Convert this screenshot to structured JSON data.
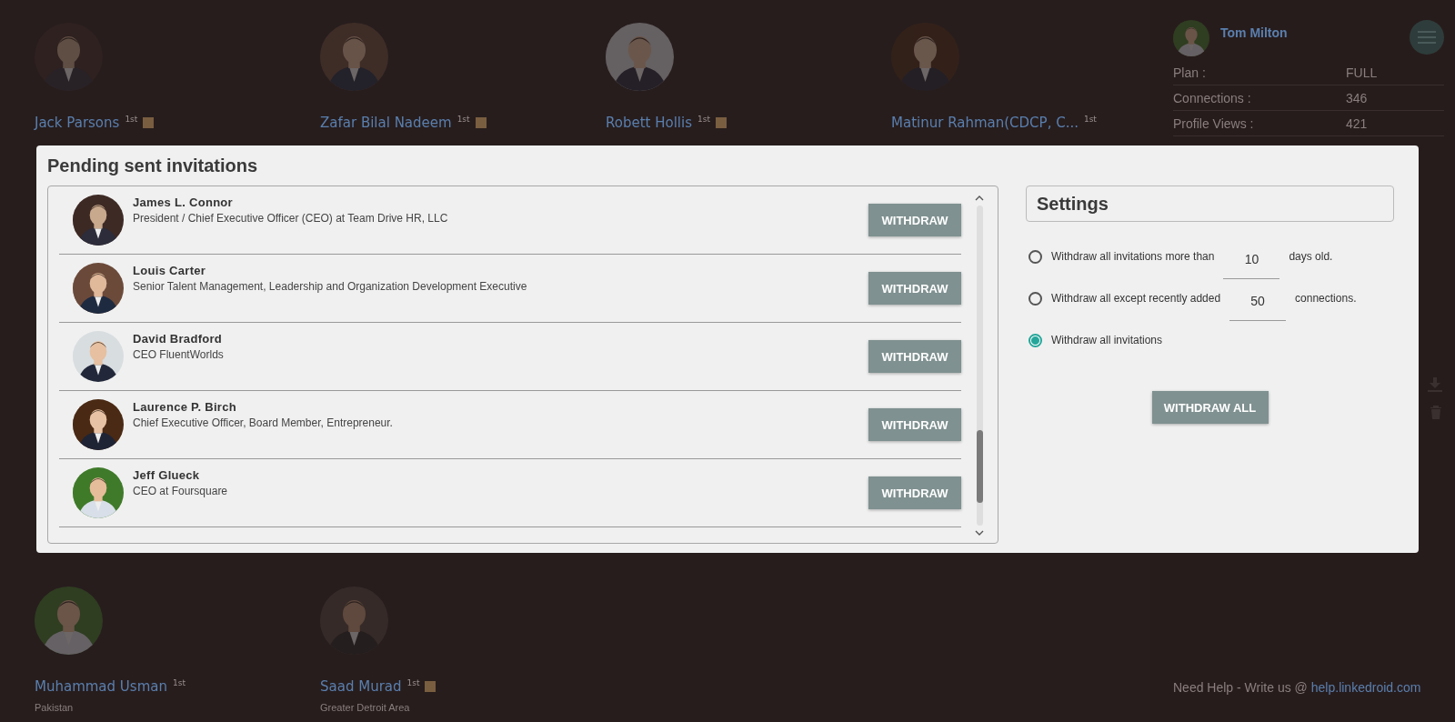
{
  "background_cards": [
    {
      "name": "Jack Parsons",
      "degree": "1st",
      "in_badge": true
    },
    {
      "name": "Zafar Bilal Nadeem",
      "degree": "1st",
      "in_badge": true
    },
    {
      "name": "Robett Hollis",
      "degree": "1st",
      "in_badge": true
    },
    {
      "name": "Matinur Rahman(CDCP, C...",
      "degree": "1st",
      "in_badge": false
    },
    {
      "name": "Muhammad Usman",
      "degree": "1st",
      "in_badge": false,
      "location": "Pakistan"
    },
    {
      "name": "Saad Murad",
      "degree": "1st",
      "in_badge": true,
      "location": "Greater Detroit Area"
    }
  ],
  "account_panel": {
    "user": "Tom Milton",
    "stats": [
      {
        "label": "Plan :",
        "value": "FULL"
      },
      {
        "label": "Connections :",
        "value": "346"
      },
      {
        "label": "Profile Views :",
        "value": "421"
      }
    ],
    "help_text": "Need Help - Write us @",
    "help_link": "help.linkedroid.com"
  },
  "dialog": {
    "title": "Pending sent invitations",
    "invitations": [
      {
        "name": "James L. Connor",
        "headline": "President / Chief Executive Officer (CEO) at Team Drive HR, LLC",
        "button": "WITHDRAW"
      },
      {
        "name": "Louis Carter",
        "headline": "Senior Talent Management, Leadership and Organization Development Executive",
        "button": "WITHDRAW"
      },
      {
        "name": "David Bradford",
        "headline": "CEO FluentWorlds",
        "button": "WITHDRAW"
      },
      {
        "name": "Laurence P. Birch",
        "headline": "Chief Executive Officer, Board Member, Entrepreneur.",
        "button": "WITHDRAW"
      },
      {
        "name": "Jeff Glueck",
        "headline": "CEO at Foursquare",
        "button": "WITHDRAW"
      }
    ],
    "settings": {
      "title": "Settings",
      "options": [
        {
          "kind": "input",
          "text": "Withdraw all invitations more than",
          "value": "10",
          "suffix": "days old.",
          "selected": false
        },
        {
          "kind": "input",
          "text": "Withdraw all except recently added",
          "value": "50",
          "suffix": "connections.",
          "selected": false
        },
        {
          "kind": "plain",
          "text": "Withdraw all invitations",
          "selected": true
        }
      ],
      "button": "WITHDRAW ALL"
    }
  }
}
